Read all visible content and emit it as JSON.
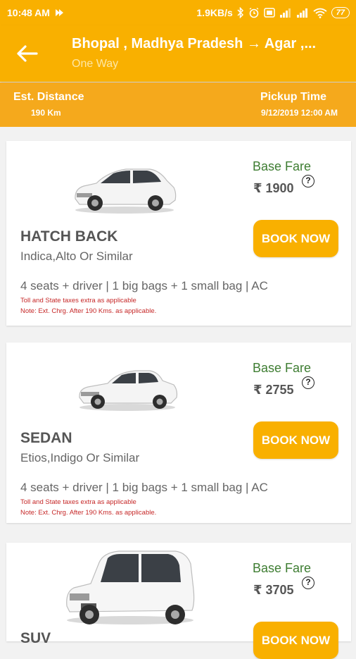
{
  "status_bar": {
    "time": "10:48 AM",
    "speed": "1.9KB/s",
    "battery": "77"
  },
  "header": {
    "title": "Bhopal , Madhya Pradesh → Agar ,...",
    "subtitle": "One Way"
  },
  "trip_info": {
    "distance_label": "Est. Distance",
    "distance_value": "190 Km",
    "pickup_label": "Pickup Time",
    "pickup_value": "9/12/2019 12:00 AM"
  },
  "cars": [
    {
      "type": "HATCH BACK",
      "models": "Indica,Alto Or Similar",
      "base_fare_label": "Base Fare",
      "fare": "₹ 1900",
      "book_label": "BOOK NOW",
      "features": "4 seats + driver | 1 big bags + 1 small bag | AC",
      "toll_note": "Toll and State taxes extra as applicable",
      "extra_note": "Note: Ext. Chrg. After 190 Kms. as applicable."
    },
    {
      "type": "SEDAN",
      "models": "Etios,Indigo Or Similar",
      "base_fare_label": "Base Fare",
      "fare": "₹ 2755",
      "book_label": "BOOK NOW",
      "features": "4 seats + driver | 1 big bags + 1 small bag | AC",
      "toll_note": "Toll and State taxes extra as applicable",
      "extra_note": "Note: Ext. Chrg. After 190 Kms. as applicable."
    },
    {
      "type": "SUV",
      "base_fare_label": "Base Fare",
      "fare": "₹ 3705",
      "book_label": "BOOK NOW"
    }
  ],
  "colors": {
    "primary": "#f9b000",
    "info_bar": "#f5a91c",
    "fare_label": "#3e7d32",
    "note": "#c62828"
  }
}
